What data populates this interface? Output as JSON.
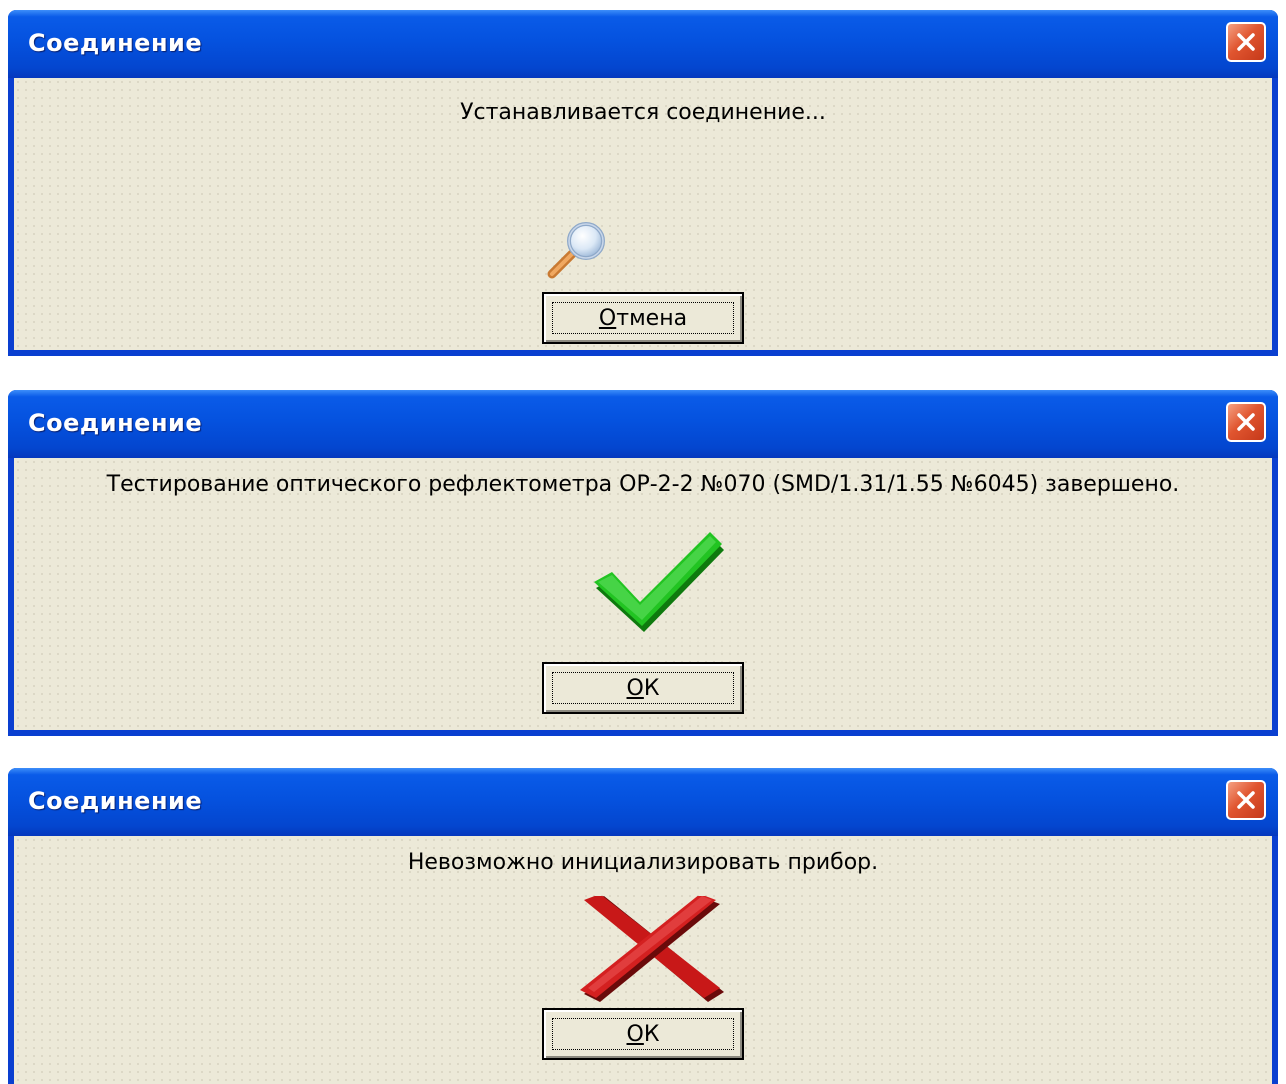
{
  "dialogs": [
    {
      "title": "Соединение",
      "message": "Устанавливается соединение...",
      "icon": "magnifier-icon",
      "button": {
        "mnemonic": "О",
        "rest": "тмена"
      }
    },
    {
      "title": "Соединение",
      "message": "Тестирование оптического рефлектометра ОР-2-2 №070 (SMD/1.31/1.55 №6045) завершено.",
      "icon": "checkmark-icon",
      "button": {
        "mnemonic": "О",
        "rest": "К"
      }
    },
    {
      "title": "Соединение",
      "message": "Невозможно инициализировать прибор.",
      "icon": "error-cross-icon",
      "button": {
        "mnemonic": "О",
        "rest": "К"
      }
    }
  ],
  "colors": {
    "titlebar": "#0552df",
    "client": "#ece9d8",
    "close": "#e0552f",
    "success": "#1bb21b",
    "error": "#b01010"
  }
}
